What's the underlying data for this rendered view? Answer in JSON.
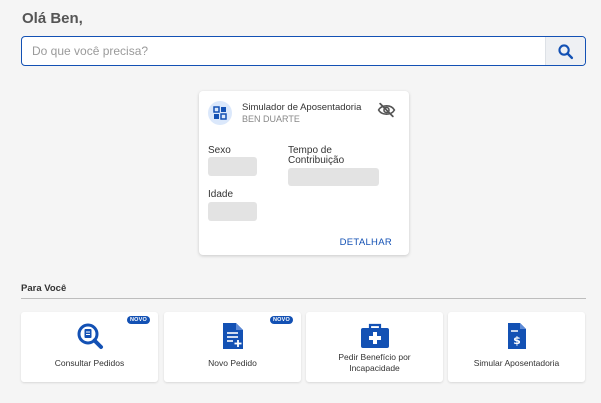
{
  "greeting": "Olá Ben,",
  "search": {
    "placeholder": "Do que você precisa?",
    "icon": "search-icon"
  },
  "simulator_card": {
    "title": "Simulador de Aposentadoria",
    "user": "BEN DUARTE",
    "fields": {
      "sexo": "Sexo",
      "tempo_line1": "Tempo de",
      "tempo_line2": "Contribuição",
      "idade": "Idade"
    },
    "detail_link": "DETALHAR",
    "icons": [
      "grid-apps-icon",
      "eye-off-icon"
    ]
  },
  "section": {
    "title": "Para Você"
  },
  "tiles": [
    {
      "label": "Consultar Pedidos",
      "badge": "NOVO",
      "icon": "search-document-icon"
    },
    {
      "label": "Novo Pedido",
      "badge": "NOVO",
      "icon": "new-document-icon"
    },
    {
      "label_line1": "Pedir Benefício por",
      "label_line2": "Incapacidade",
      "icon": "medical-kit-icon"
    },
    {
      "label": "Simular Aposentadoria",
      "icon": "money-document-icon"
    }
  ],
  "colors": {
    "primary": "#1351b4",
    "background": "#f5f5f5",
    "placeholder_block": "#e3e3e3"
  }
}
